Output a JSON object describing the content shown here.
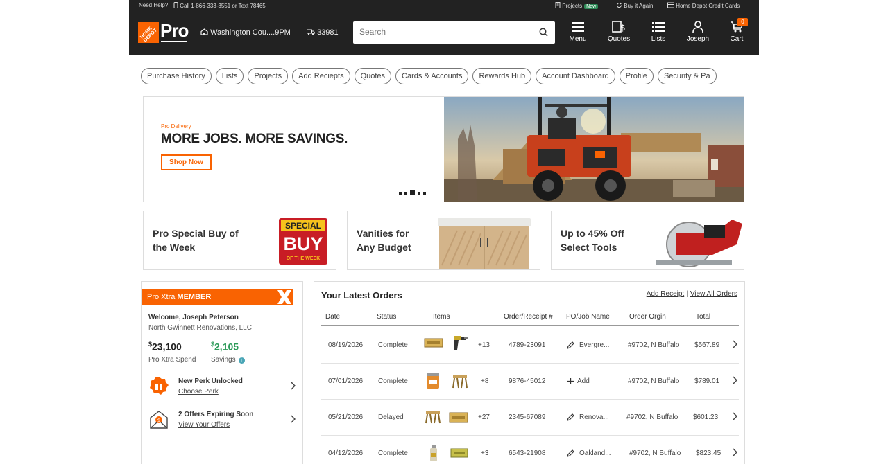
{
  "util_bar": {
    "help": "Need Help?",
    "phone": "Call 1-866-333-3551 or Text 78465",
    "projects": "Projects",
    "projects_badge": "New",
    "buy_again": "Buy it Again",
    "credit": "Home Depot Credit Cards"
  },
  "header": {
    "logo_text": "Pro",
    "logo_mark": "HOME DEPOT",
    "store": "Washington Cou....9PM",
    "zip": "33981",
    "search_placeholder": "Search",
    "nav": {
      "menu": "Menu",
      "quotes": "Quotes",
      "lists": "Lists",
      "account": "Joseph",
      "cart": "Cart",
      "cart_count": "0"
    }
  },
  "chips": [
    "Purchase History",
    "Lists",
    "Projects",
    "Add Reciepts",
    "Quotes",
    "Cards & Accounts",
    "Rewards Hub",
    "Account Dashboard",
    "Profile",
    "Security & Pa"
  ],
  "hero": {
    "eyebrow": "Pro Delivery",
    "headline": "MORE JOBS. MORE SAVINGS.",
    "cta": "Shop Now"
  },
  "promos": {
    "special": {
      "line1": "Pro Special Buy of",
      "line2": "the Week",
      "badge_top": "SPECIAL",
      "badge_main": "BUY",
      "badge_bottom": "OF THE WEEK"
    },
    "vanities": {
      "line1": "Vanities for",
      "line2": "Any Budget"
    },
    "tools": {
      "line1": "Up to 45% Off",
      "line2": "Select Tools"
    }
  },
  "member": {
    "banner_prefix": "Pro Xtra",
    "banner_bold": "MEMBER",
    "welcome": "Welcome, Joseph Peterson",
    "company": "North Gwinnett Renovations, LLC",
    "spend_sup": "$",
    "spend": "23,100",
    "spend_label": "Pro Xtra Spend",
    "savings_sup": "$",
    "savings": "2,105",
    "savings_label": "Savings",
    "perk_title": "New Perk Unlocked",
    "perk_link": "Choose Perk",
    "offers_title": "2 Offers Expiring Soon",
    "offers_link": "View Your Offers"
  },
  "orders": {
    "title": "Your Latest Orders",
    "add_receipt": "Add Receipt",
    "view_all": "View All Orders",
    "sep": "|",
    "columns": [
      "Date",
      "Status",
      "Items",
      "Order/Receipt #",
      "PO/Job Name",
      "Order Orgin",
      "Total"
    ],
    "rows": [
      {
        "date": "08/19/2026",
        "status": "Complete",
        "more": "+13",
        "order": "4789-23091",
        "po": "Evergre...",
        "origin": "#9702, N Buffalo",
        "total": "$567.89"
      },
      {
        "date": "07/01/2026",
        "status": "Complete",
        "more": "+8",
        "order": "9876-45012",
        "po": "Add",
        "origin": "#9702, N Buffalo",
        "total": "$789.01"
      },
      {
        "date": "05/21/2026",
        "status": "Delayed",
        "more": "+27",
        "order": "2345-67089",
        "po": "Renova...",
        "origin": "#9702, N Buffalo",
        "total": "$601.23"
      },
      {
        "date": "04/12/2026",
        "status": "Complete",
        "more": "+3",
        "order": "6543-21908",
        "po": "Oakland...",
        "origin": "#9702, N Buffalo",
        "total": "$823.45"
      }
    ]
  },
  "colors": {
    "brand_orange": "#f96302",
    "header_bg": "#222222",
    "savings_green": "#2e9b5a"
  }
}
